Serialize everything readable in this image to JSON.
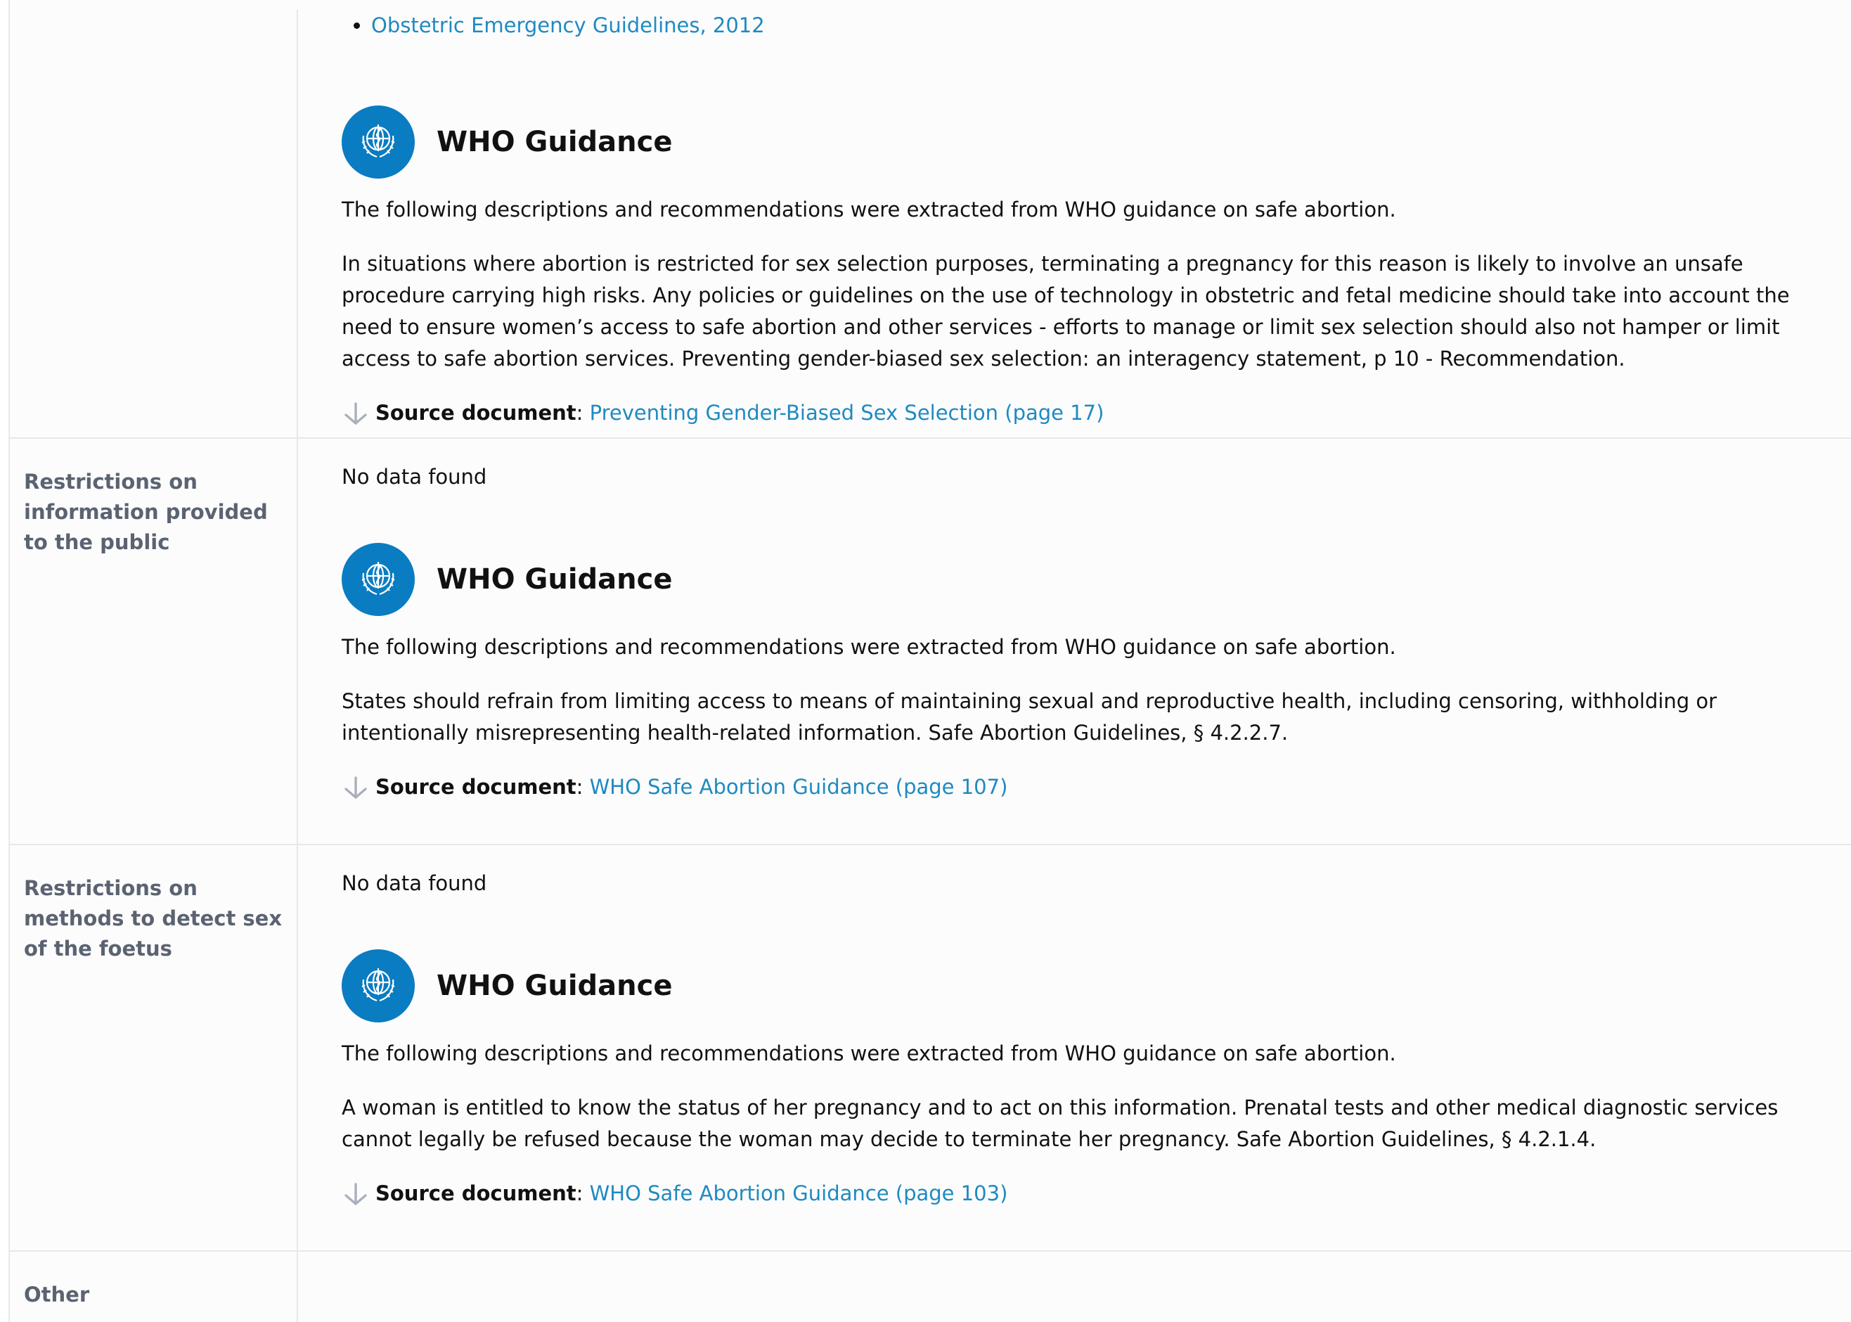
{
  "section1": {
    "link": "Obstetric Emergency Guidelines, 2012",
    "who_title": "WHO Guidance",
    "intro": "The following descriptions and recommendations were extracted from WHO guidance on safe abortion.",
    "body": "In situations where abortion is restricted for sex selection purposes, terminating a pregnancy for this reason is likely to involve an unsafe procedure carrying high risks. Any policies or guidelines on the use of technology in obstetric and fetal medicine should take into account the need to ensure women’s access to safe abortion and other services - efforts to manage or limit sex selection should also not hamper or limit access to safe abortion services. Preventing gender-biased sex selection: an interagency statement, p 10 - Recommendation.",
    "source_label": "Source document",
    "source_sep": ": ",
    "source_link": "Preventing Gender-Biased Sex Selection (page 17)"
  },
  "section2": {
    "label": "Restrictions on information provided to the public",
    "no_data": "No data found",
    "who_title": "WHO Guidance",
    "intro": "The following descriptions and recommendations were extracted from WHO guidance on safe abortion.",
    "body": "States should refrain from limiting access to means of maintaining sexual and reproductive health, including censoring, withholding or intentionally misrepresenting health-related information. Safe Abortion Guidelines, § 4.2.2.7.",
    "source_label": "Source document",
    "source_sep": ": ",
    "source_link": "WHO Safe Abortion Guidance (page 107)"
  },
  "section3": {
    "label": "Restrictions on methods to detect sex of the foetus",
    "no_data": "No data found",
    "who_title": "WHO Guidance",
    "intro": "The following descriptions and recommendations were extracted from WHO guidance on safe abortion.",
    "body": "A woman is entitled to know the status of her pregnancy and to act on this information. Prenatal tests and other medical diagnostic services cannot legally be refused because the woman may decide to terminate her pregnancy. Safe Abortion Guidelines, § 4.2.1.4.",
    "source_label": "Source document",
    "source_sep": ": ",
    "source_link": "WHO Safe Abortion Guidance (page 103)"
  },
  "section4": {
    "label": "Other"
  },
  "colors": {
    "link": "#1f8ac0",
    "who_blue": "#0a7cc2",
    "label_gray": "#5b6371",
    "border": "#e6e8ea"
  },
  "icons": {
    "logo": "who-emblem-icon",
    "download": "arrow-down-icon"
  }
}
